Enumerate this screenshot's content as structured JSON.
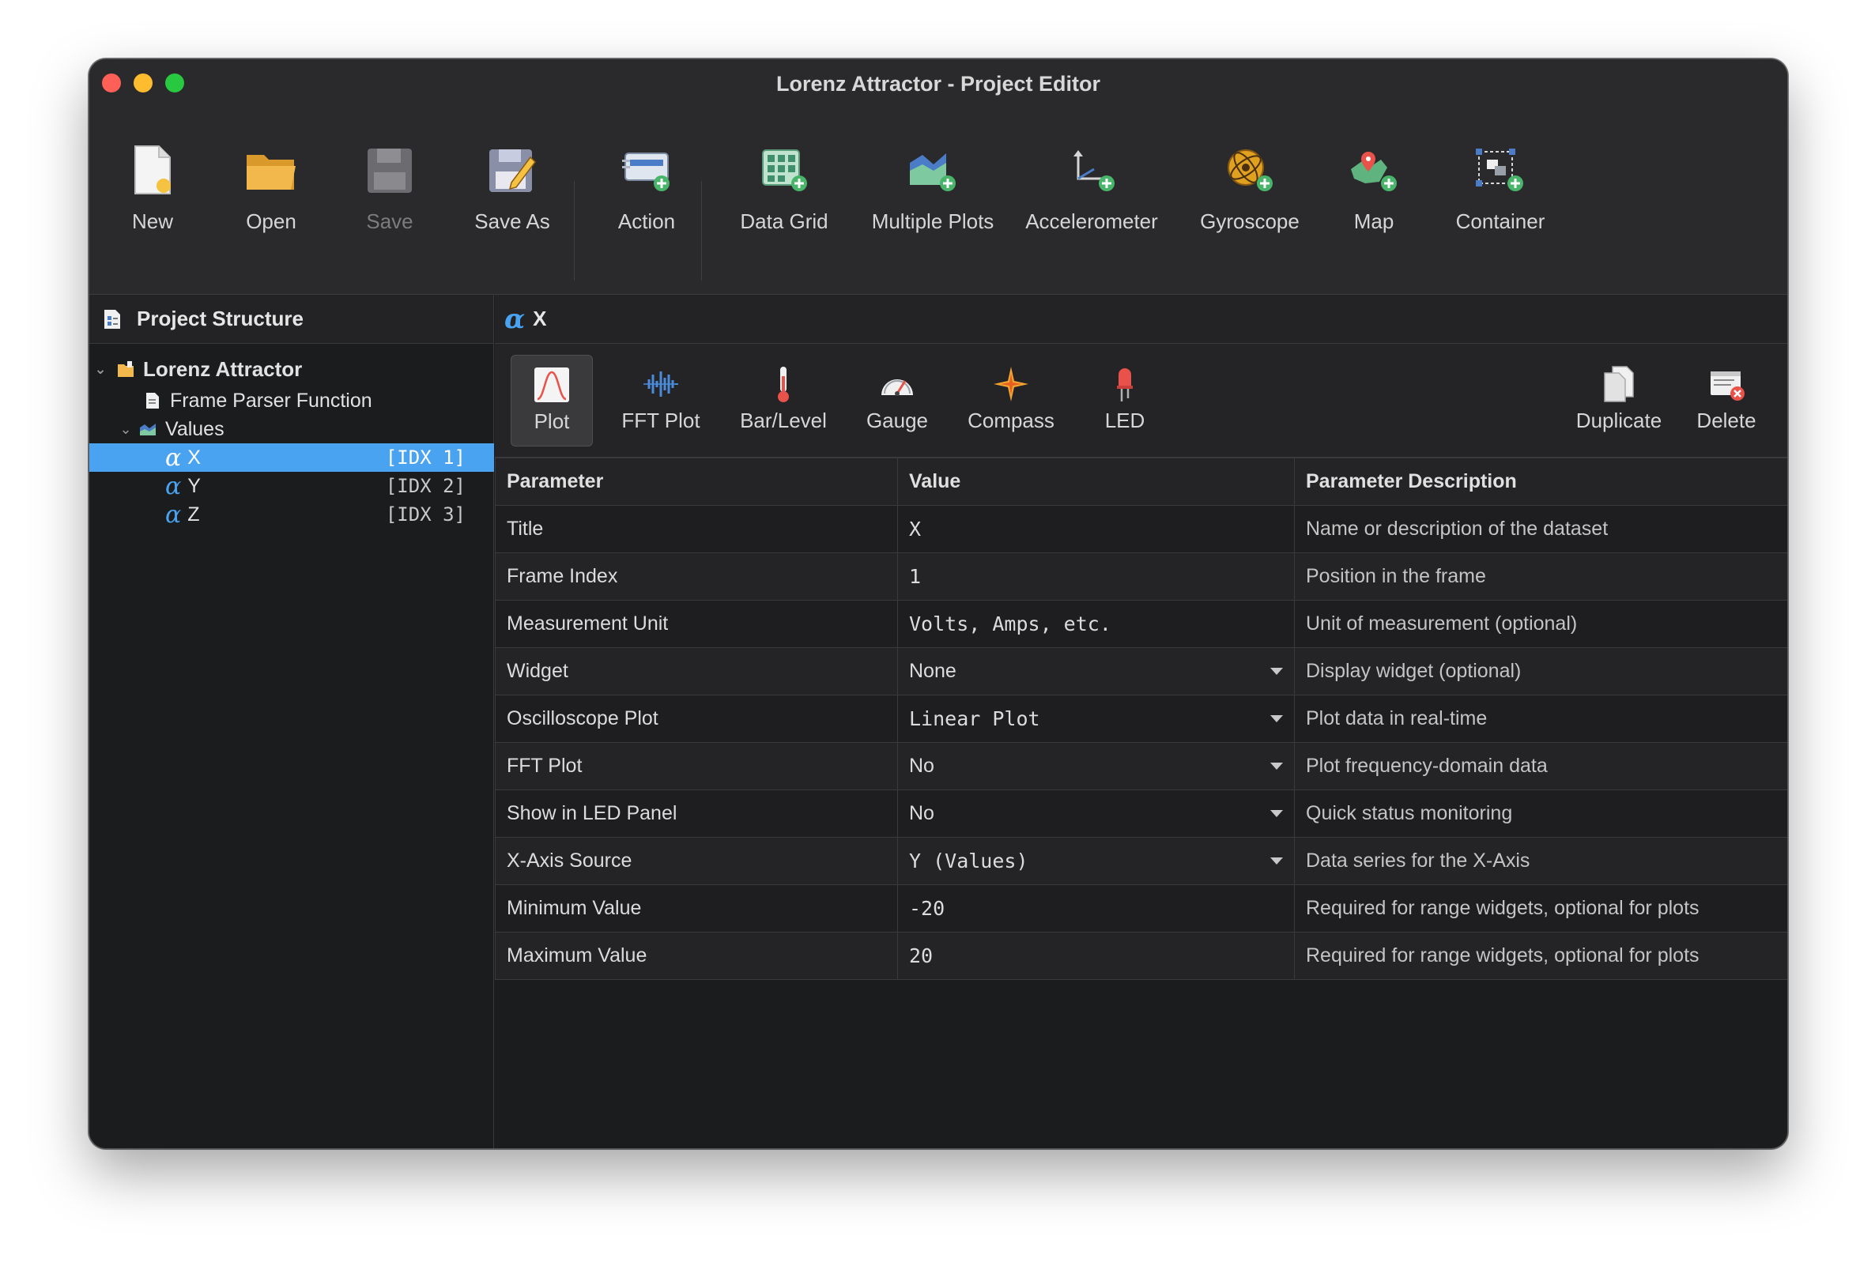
{
  "window": {
    "title": "Lorenz Attractor - Project Editor"
  },
  "toolbar": {
    "new": "New",
    "open": "Open",
    "save": "Save",
    "save_as": "Save As",
    "action": "Action",
    "data_grid": "Data Grid",
    "multiple_plots": "Multiple Plots",
    "accelerometer": "Accelerometer",
    "gyroscope": "Gyroscope",
    "map": "Map",
    "container": "Container"
  },
  "sidebar": {
    "title": "Project Structure",
    "root": "Lorenz Attractor",
    "frame_parser": "Frame Parser Function",
    "values_group": "Values",
    "items": [
      {
        "label": "X",
        "index": "[IDX 1]"
      },
      {
        "label": "Y",
        "index": "[IDX 2]"
      },
      {
        "label": "Z",
        "index": "[IDX 3]"
      }
    ]
  },
  "main": {
    "title": "X",
    "widgets": {
      "plot": "Plot",
      "fft_plot": "FFT Plot",
      "bar_level": "Bar/Level",
      "gauge": "Gauge",
      "compass": "Compass",
      "led": "LED",
      "duplicate": "Duplicate",
      "delete": "Delete"
    },
    "table": {
      "headers": [
        "Parameter",
        "Value",
        "Parameter Description"
      ],
      "rows": [
        {
          "param": "Title",
          "value": "X",
          "desc": "Name or description of the dataset"
        },
        {
          "param": "Frame Index",
          "value": "1",
          "desc": "Position in the frame"
        },
        {
          "param": "Measurement Unit",
          "value": "",
          "placeholder": "Volts, Amps, etc.",
          "desc": "Unit of measurement (optional)"
        },
        {
          "param": "Widget",
          "value": "None",
          "desc": "Display widget (optional)"
        },
        {
          "param": "Oscilloscope Plot",
          "value": "Linear Plot",
          "desc": "Plot data in real-time"
        },
        {
          "param": "FFT Plot",
          "value": "No",
          "desc": "Plot frequency-domain data"
        },
        {
          "param": "Show in LED Panel",
          "value": "No",
          "desc": "Quick status monitoring"
        },
        {
          "param": "X-Axis Source",
          "value": "Y (Values)",
          "desc": "Data series for the X-Axis"
        },
        {
          "param": "Minimum Value",
          "value": "-20",
          "desc": "Required for range widgets, optional for plots"
        },
        {
          "param": "Maximum Value",
          "value": "20",
          "desc": "Required for range widgets, optional for plots"
        }
      ]
    }
  }
}
